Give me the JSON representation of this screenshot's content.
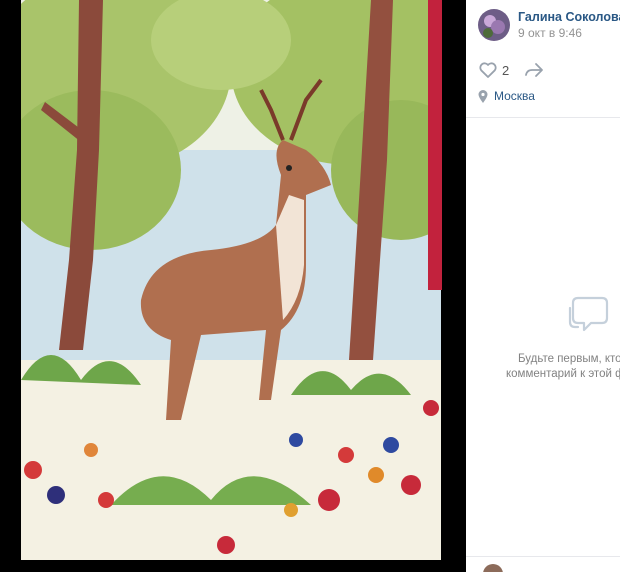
{
  "post": {
    "author_name": "Галина Соколова",
    "date": "9 окт в 9:46",
    "like_count": "2",
    "location": "Москва"
  },
  "comments": {
    "empty_line1": "Будьте первым, кто о",
    "empty_line2": "комментарий к этой фо"
  },
  "icons": {
    "like": "heart-icon",
    "share": "share-arrow-icon",
    "location": "map-pin-icon",
    "comment": "comment-bubble-icon"
  },
  "colors": {
    "link": "#2a5885",
    "muted": "#939393",
    "icon": "#99a2ad",
    "backdrop": "#000000"
  }
}
